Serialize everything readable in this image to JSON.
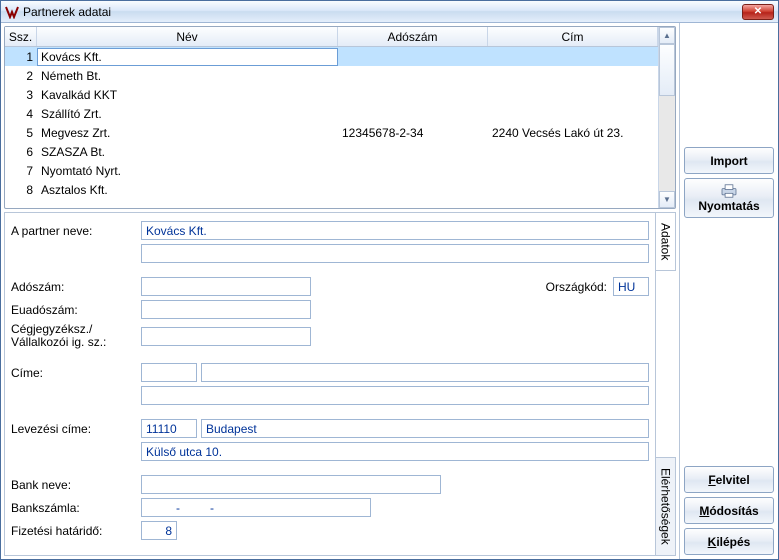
{
  "title": "Partnerek adatai",
  "close_icon": "✕",
  "grid": {
    "headers": {
      "ssz": "Ssz.",
      "nev": "Név",
      "ado": "Adószám",
      "cim": "Cím"
    },
    "rows": [
      {
        "ssz": "1",
        "nev": "Kovács Kft.",
        "ado": "",
        "cim": ""
      },
      {
        "ssz": "2",
        "nev": "Németh Bt.",
        "ado": "",
        "cim": ""
      },
      {
        "ssz": "3",
        "nev": "Kavalkád KKT",
        "ado": "",
        "cim": ""
      },
      {
        "ssz": "4",
        "nev": "Szállító Zrt.",
        "ado": "",
        "cim": ""
      },
      {
        "ssz": "5",
        "nev": "Megvesz Zrt.",
        "ado": "12345678-2-34",
        "cim": "2240 Vecsés Lakó út 23."
      },
      {
        "ssz": "6",
        "nev": "SZASZA Bt.",
        "ado": "",
        "cim": ""
      },
      {
        "ssz": "7",
        "nev": "Nyomtató Nyrt.",
        "ado": "",
        "cim": ""
      },
      {
        "ssz": "8",
        "nev": "Asztalos Kft.",
        "ado": "",
        "cim": ""
      }
    ],
    "selected_index": 0
  },
  "tabs": {
    "adatok": "Adatok",
    "elerhetosegek": "Elérhetőségek"
  },
  "form": {
    "labels": {
      "partner_neve": "A partner neve:",
      "adoszam": "Adószám:",
      "euadoszam": "Euadószám:",
      "orszagkod": "Országkód:",
      "cegjegyzek": "Cégjegyzéksz./\nVállalkozói ig. sz.:",
      "cime": "Címe:",
      "levelezesi": "Levezési címe:",
      "bank_neve": "Bank neve:",
      "bankszamla": "Bankszámla:",
      "fizhat": "Fizetési határidő:"
    },
    "values": {
      "partner_neve": "Kovács Kft.",
      "partner_neve_2": "",
      "adoszam": "",
      "euadoszam": "",
      "orszagkod": "HU",
      "cegjegyzek": "",
      "cim_irsz": "",
      "cim_varos": "",
      "cim_utca": "",
      "lev_irsz": "11110",
      "lev_varos": "Budapest",
      "lev_utca": "Külső utca 10.",
      "bank_neve": "",
      "bankszamla": "         -         -",
      "fizhat": "8"
    }
  },
  "buttons": {
    "import": "Import",
    "nyomtatas": "Nyomtatás",
    "felvitel_pre": "F",
    "felvitel_post": "elvitel",
    "modositas_pre": "M",
    "modositas_post": "ódosítás",
    "kilepes_pre": "K",
    "kilepes_post": "ilépés"
  }
}
